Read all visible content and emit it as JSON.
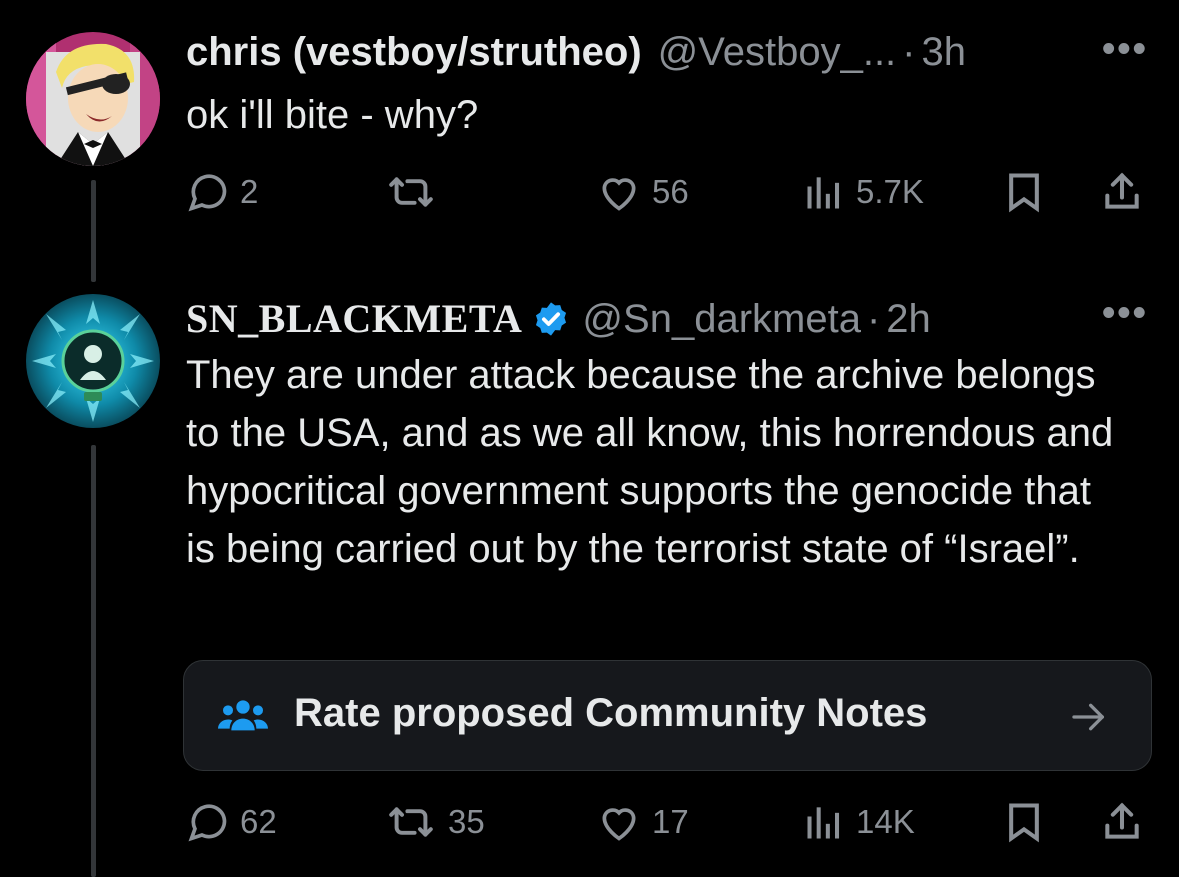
{
  "tweets": [
    {
      "display_name": "chris (vestboy/strutheo)",
      "handle": "@Vestboy_...",
      "separator": "·",
      "time": "3h",
      "text": "ok i'll bite - why?",
      "stats": {
        "replies": "2",
        "reposts": "",
        "likes": "56",
        "views": "5.7K"
      },
      "avatar_icon": "cartoon-avatar-icon"
    },
    {
      "display_name": "SN_BLACKMETA",
      "verified": true,
      "handle": "@Sn_darkmeta",
      "separator": "·",
      "time": "2h",
      "text": "They are under attack because the archive belongs to the USA, and as we all know, this horrendous and hypocritical government supports the genocide that is being carried out by the terrorist state of “Israel”.",
      "stats": {
        "replies": "62",
        "reposts": "35",
        "likes": "17",
        "views": "14K"
      },
      "avatar_icon": "emblem-avatar-icon"
    }
  ],
  "community_notes": {
    "label": "Rate proposed Community Notes"
  },
  "colors": {
    "background": "#000000",
    "text": "#e7e9ea",
    "muted": "#8b9096",
    "accent": "#1d9bf0",
    "card": "#16181c"
  }
}
